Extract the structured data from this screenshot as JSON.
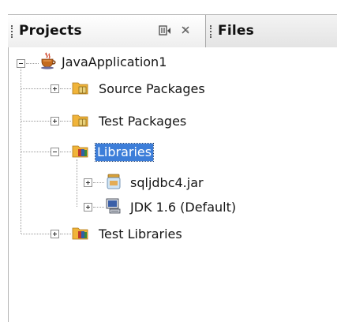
{
  "tabs": {
    "projects_label": "Projects",
    "files_label": "Files"
  },
  "tree": {
    "root": "JavaApplication1",
    "source_packages": "Source Packages",
    "test_packages": "Test Packages",
    "libraries": "Libraries",
    "sqljdbc": "sqljdbc4.jar",
    "jdk": "JDK 1.6 (Default)",
    "test_libraries": "Test Libraries"
  },
  "colors": {
    "selection": "#3d7ed9",
    "folder": "#f0b43a"
  },
  "icons": {
    "root": "java-cup-icon",
    "package_folder": "package-folder-icon",
    "library_folder": "library-folder-icon",
    "jar": "jar-icon",
    "jdk": "monitor-icon"
  }
}
